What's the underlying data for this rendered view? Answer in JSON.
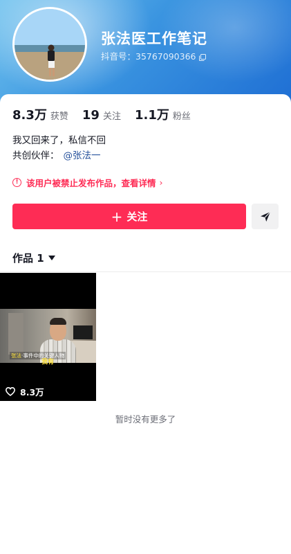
{
  "profile": {
    "nickname": "张法医工作笔记",
    "douyin_id": "抖音号：35767090366"
  },
  "stats": [
    {
      "value": "8.3万",
      "label": "获赞"
    },
    {
      "value": "19",
      "label": "关注"
    },
    {
      "value": "1.1万",
      "label": "粉丝"
    }
  ],
  "bio": "我又回来了，私信不回",
  "cocreate": {
    "label": "共创伙伴：",
    "partner": "@张法一"
  },
  "notice": {
    "text": "该用户被禁止发布作品，查看详情",
    "chevron": "›",
    "color": "#fe2c55"
  },
  "actions": {
    "follow_label": "关注",
    "follow_plus": "+",
    "share_icon": "paper-plane-icon"
  },
  "works": {
    "tab_label": "作品 1",
    "videos": [
      {
        "likes": "8.3万",
        "caption_line1_a": "张法",
        "caption_line1_b": "·事件中的关键人物",
        "caption_line2": "我有"
      }
    ],
    "end_text": "暂时没有更多了"
  },
  "colors": {
    "accent": "#fe2c55",
    "mention": "#26519c",
    "header_blue": "#3a94e0"
  }
}
